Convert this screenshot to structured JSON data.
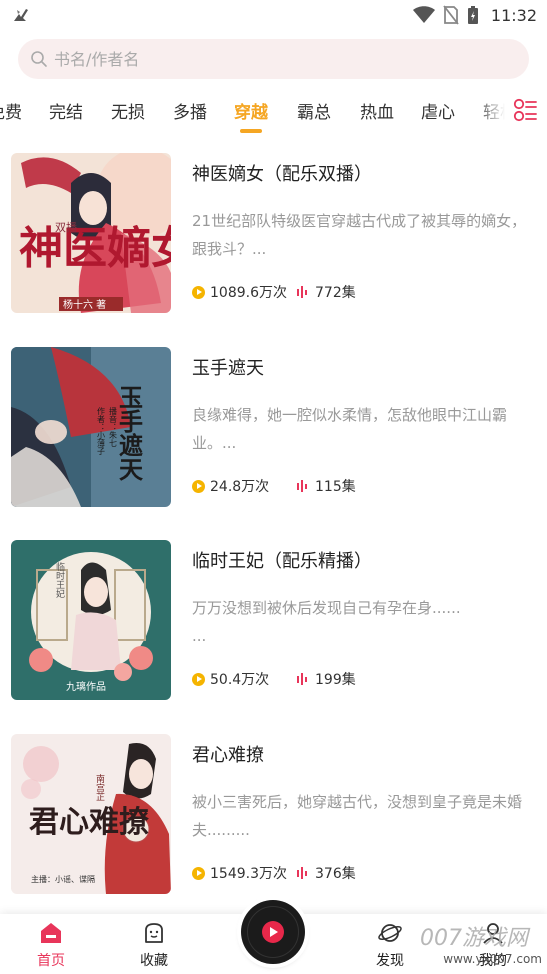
{
  "status_bar": {
    "time": "11:32",
    "icons": [
      "bird-notification-icon",
      "wifi-icon",
      "no-sim-icon",
      "battery-charging-icon"
    ]
  },
  "search": {
    "placeholder": "书名/作者名",
    "value": "",
    "icon": "search-icon"
  },
  "tabs": {
    "items": [
      "免费",
      "完结",
      "无损",
      "多播",
      "穿越",
      "霸总",
      "热血",
      "虐心",
      "轻松"
    ],
    "active": "穿越",
    "menu_icon": "category-grid-icon"
  },
  "books": [
    {
      "title": "神医嫡女（配乐双播）",
      "desc": "21世纪部队特级医官穿越古代成了被其辱的嫡女，跟我斗？...",
      "plays": "1089.6万次",
      "episodes": "772集",
      "cover": {
        "calligraphy": "神医嫡女",
        "author": "杨十六 著",
        "tag": "双播"
      }
    },
    {
      "title": "玉手遮天",
      "desc": "良缘难得，她一腔似水柔情，怎敌他眼中江山霸业。...",
      "plays": "24.8万次",
      "episodes": "115集",
      "cover": {
        "calligraphy": "玉手遮天",
        "author": "作者：小薄子",
        "tag": "播音：朱七"
      }
    },
    {
      "title": "临时王妃（配乐精播）",
      "desc": "万万没想到被休后发现自己有孕在身......\n...",
      "plays": "50.4万次",
      "episodes": "199集",
      "cover": {
        "calligraphy": "临时王妃",
        "author": "九璃作品"
      }
    },
    {
      "title": "君心难撩",
      "desc": "被小三害死后，她穿越古代，没想到皇子竟是未婚夫.........",
      "plays": "1549.3万次",
      "episodes": "376集",
      "cover": {
        "calligraphy": "君心难撩",
        "author": "主播：小谣、谍隔",
        "tag": "南宫芷"
      }
    }
  ],
  "bottom_nav": {
    "items": [
      {
        "label": "首页",
        "icon": "home-icon",
        "active": true
      },
      {
        "label": "收藏",
        "icon": "favorite-box-icon",
        "active": false
      },
      {
        "label": "发现",
        "icon": "discover-planet-icon",
        "active": false
      },
      {
        "label": "我的",
        "icon": "profile-icon",
        "active": false
      }
    ],
    "player_icon": "play-disc-icon"
  },
  "watermark": {
    "text": "007游戏网",
    "url": "www.yx007.com"
  },
  "colors": {
    "accent": "#f5a623",
    "brand_red": "#e8355a",
    "search_bg": "#f9eeee",
    "desc_text": "#999999"
  }
}
